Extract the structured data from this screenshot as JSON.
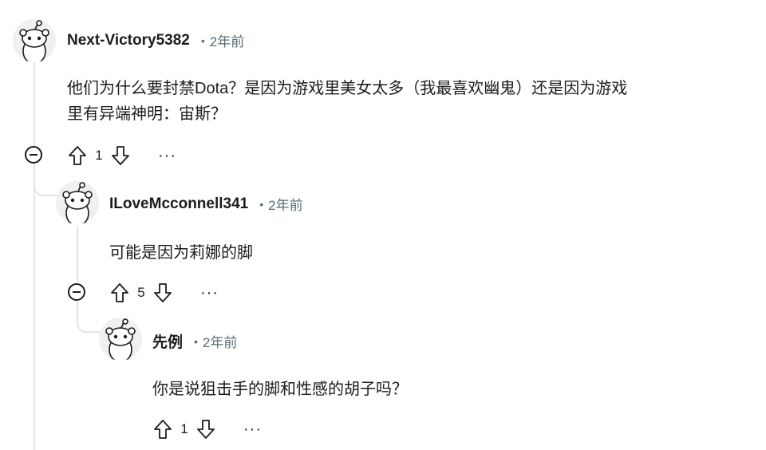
{
  "comments": [
    {
      "username": "Next-Victory5382",
      "separator": "•",
      "time": "2年前",
      "body_lines": [
        "他们为什么要封禁Dota？是因为游戏里美女太多（我最喜欢幽鬼）还是因为游戏",
        "里有异端神明：宙斯？"
      ],
      "votes": "1",
      "more": "···"
    },
    {
      "username": "ILoveMcconnell341",
      "separator": "•",
      "time": "2年前",
      "body_lines": [
        "可能是因为莉娜的脚"
      ],
      "votes": "5",
      "more": "···"
    },
    {
      "username": "先例",
      "separator": "•",
      "time": "2年前",
      "body_lines": [
        "你是说狙击手的脚和性感的胡子吗？"
      ],
      "votes": "1",
      "more": "···"
    }
  ],
  "icons": {
    "avatar": "reddit-snoo-avatar-icon",
    "upvote": "upvote-arrow-icon",
    "downvote": "downvote-arrow-icon",
    "collapse": "collapse-minus-icon",
    "more": "more-options-icon"
  },
  "colors": {
    "text": "#1c1c1c",
    "meta": "#576f76",
    "thread_line": "#e2e4e6",
    "avatar_bg": "#eef0f2"
  }
}
